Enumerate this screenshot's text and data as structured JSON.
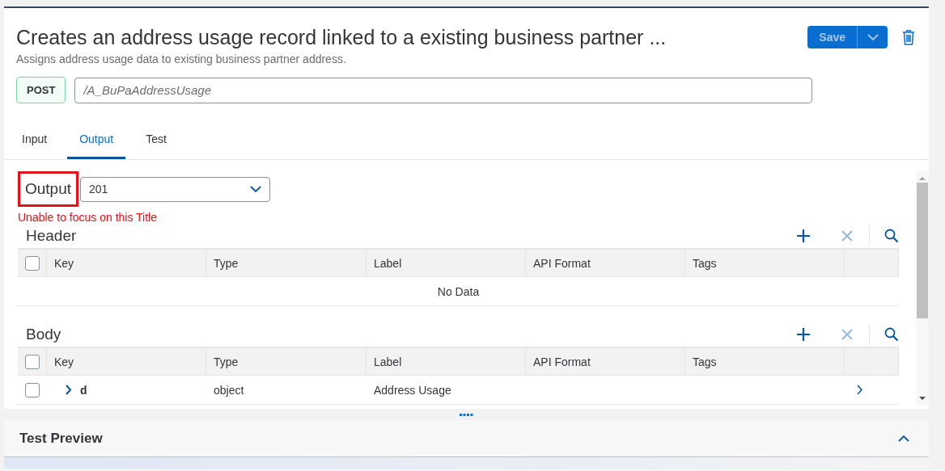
{
  "header": {
    "title": "Creates an address usage record linked to a existing business partner ...",
    "subtitle": "Assigns address usage data to existing business partner address.",
    "save_button": "Save",
    "method": "POST",
    "path": "/A_BuPaAddressUsage"
  },
  "tabs": [
    {
      "label": "Input",
      "selected": false
    },
    {
      "label": "Output",
      "selected": true
    },
    {
      "label": "Test",
      "selected": false
    }
  ],
  "output": {
    "label": "Output",
    "highlighted": true,
    "status_select": "201",
    "annotation": "Unable to focus on this Title"
  },
  "sections": [
    {
      "title": "Header",
      "columns": [
        "Key",
        "Type",
        "Label",
        "API Format",
        "Tags"
      ],
      "select_all_checked": false,
      "empty_text": "No Data"
    },
    {
      "title": "Body",
      "columns": [
        "Key",
        "Type",
        "Label",
        "API Format",
        "Tags"
      ],
      "select_all_checked": false,
      "rows": [
        {
          "key": "d",
          "type": "object",
          "label": "Address Usage",
          "checked": false,
          "expanded": false
        }
      ]
    }
  ],
  "test_preview": {
    "title": "Test Preview",
    "expanded": true
  }
}
